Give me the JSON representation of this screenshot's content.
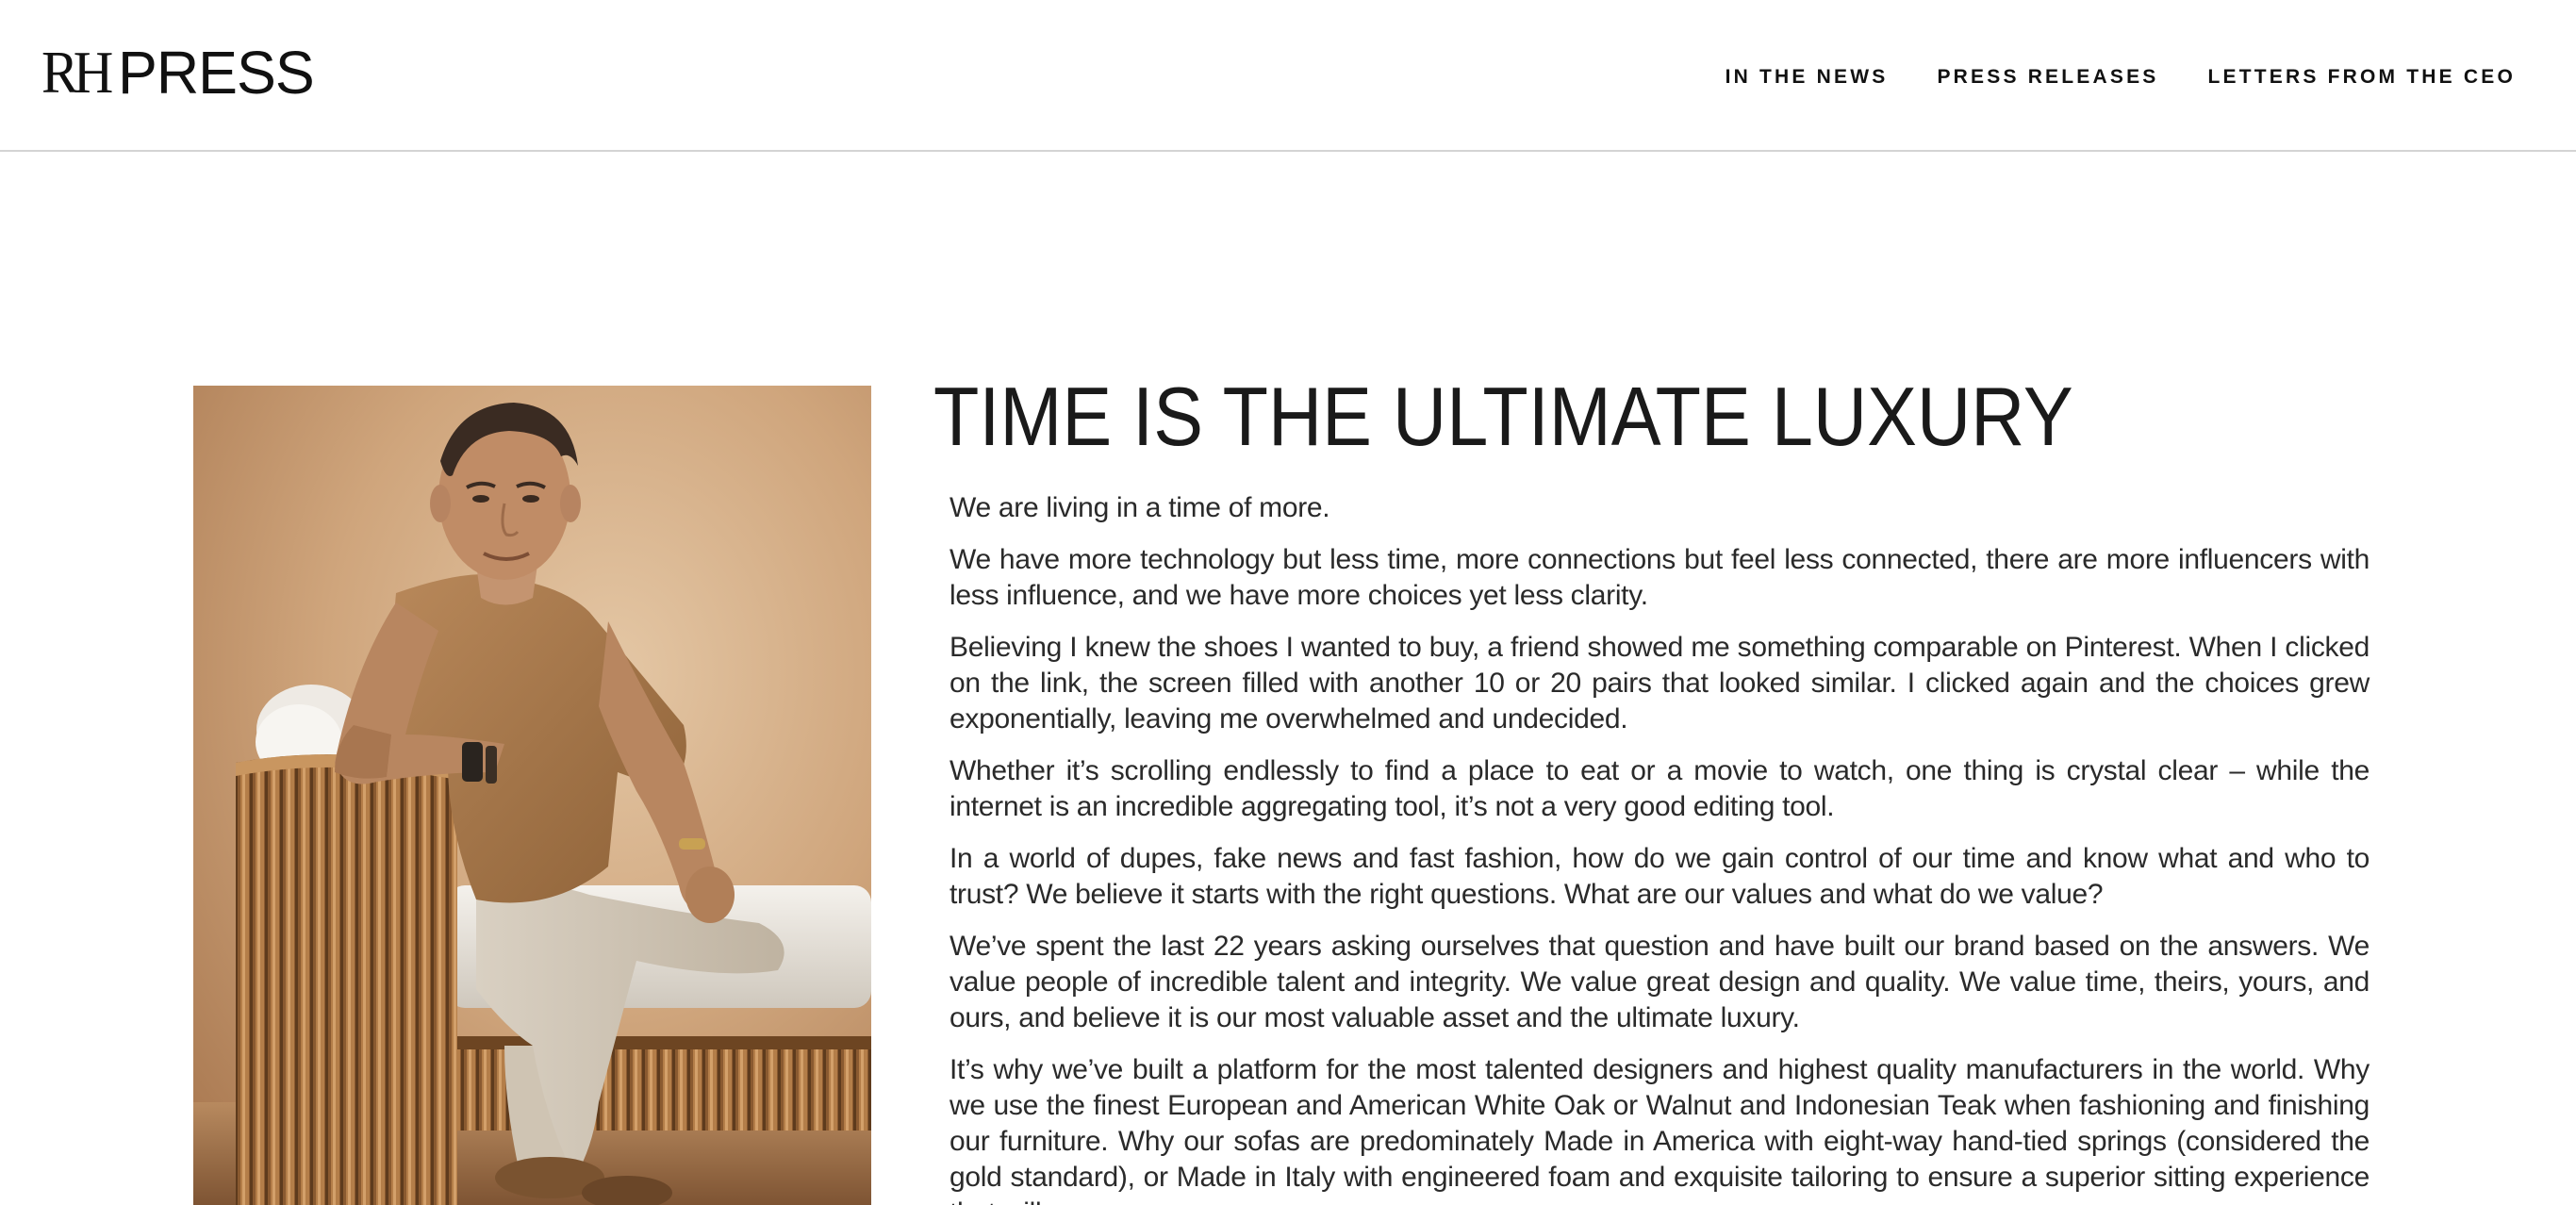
{
  "header": {
    "logo_rh": "RH",
    "logo_press": "PRESS",
    "nav": [
      {
        "label": "IN THE NEWS"
      },
      {
        "label": "PRESS RELEASES"
      },
      {
        "label": "LETTERS FROM THE CEO"
      }
    ]
  },
  "article": {
    "title": "TIME IS THE ULTIMATE LUXURY",
    "paragraphs": [
      "We are living in a time of more.",
      "We have more technology but less time, more connections but feel less connected, there are more influencers with less influence, and we have more choices yet less clarity.",
      "Believing I knew the shoes I wanted to buy, a friend showed me something comparable on Pinterest. When I clicked on the link, the screen filled with another 10 or 20 pairs that looked similar. I clicked again and the choices grew exponentially, leaving me overwhelmed and undecided.",
      "Whether it’s scrolling endlessly to find a place to eat or a movie to watch, one thing is crystal clear – while the internet is an incredible aggregating tool, it’s not a very good editing tool.",
      "In a world of dupes, fake news and fast fashion, how do we gain control of our time and know what and who to trust? We believe it starts with the right questions. What are our values and what do we value?",
      "We’ve spent the last 22 years asking ourselves that question and have built our brand based on the answers. We value people of incredible talent and integrity. We value great design and quality. We value time, theirs, yours, and ours, and believe it is our most valuable asset and the ultimate luxury.",
      "It’s why we’ve built a platform for the most talented designers and highest quality manufacturers in the world. Why we use the finest European and American White Oak or Walnut and Indonesian Teak when fashioning and finishing our furniture. Why our sofas are predominately Made in America with eight-way hand-tied springs (considered the gold standard), or Made in Italy with engineered foam and exquisite tailoring to ensure a superior sitting experience that will"
    ]
  },
  "colors": {
    "text": "#1a1a1a",
    "divider": "#d4d4d4",
    "photo_background": "#c9a27c",
    "shirt": "#a77a4d",
    "wood": "#8b5a2e"
  }
}
